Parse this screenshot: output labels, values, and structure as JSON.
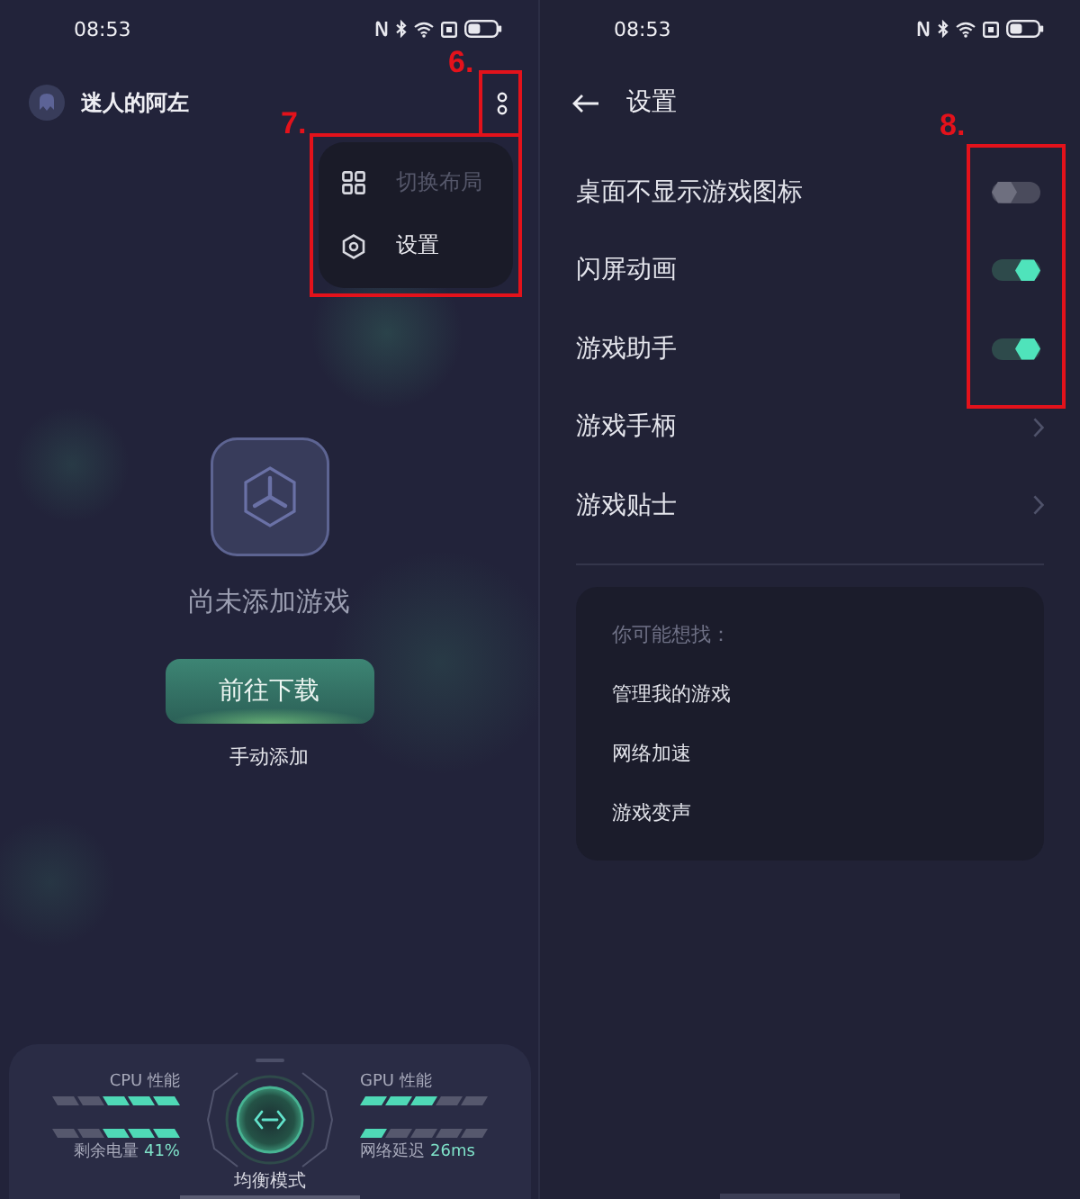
{
  "left_screen": {
    "status_bar": {
      "time": "08:53"
    },
    "header": {
      "user_name": "迷人的阿左",
      "more_annotation": "6."
    },
    "menu": {
      "annotation": "7.",
      "items": [
        {
          "label": "切换布局",
          "disabled": true
        },
        {
          "label": "设置",
          "disabled": false
        }
      ]
    },
    "empty_state": {
      "message": "尚未添加游戏",
      "download_button": "前往下载",
      "manual_add_link": "手动添加"
    },
    "performance_panel": {
      "left_meters": [
        {
          "label": "CPU 性能",
          "level": 0.6
        },
        {
          "label": "剩余电量",
          "reading": "41%",
          "level": 0.6
        }
      ],
      "mode": "均衡模式",
      "right_meters": [
        {
          "label": "GPU 性能",
          "level": 0.6
        },
        {
          "label": "网络延迟",
          "reading": "26ms",
          "level": 0.2
        }
      ]
    }
  },
  "right_screen": {
    "status_bar": {
      "time": "08:53"
    },
    "header": {
      "title": "设置"
    },
    "settings_annotation": "8.",
    "settings": [
      {
        "kind": "toggle",
        "label": "桌面不显示游戏图标",
        "on": false
      },
      {
        "kind": "toggle",
        "label": "闪屏动画",
        "on": true
      },
      {
        "kind": "toggle",
        "label": "游戏助手",
        "on": true
      },
      {
        "kind": "link",
        "label": "游戏手柄"
      },
      {
        "kind": "link",
        "label": "游戏贴士"
      }
    ],
    "suggestions": {
      "title": "你可能想找：",
      "items": [
        "管理我的游戏",
        "网络加速",
        "游戏变声"
      ]
    }
  }
}
